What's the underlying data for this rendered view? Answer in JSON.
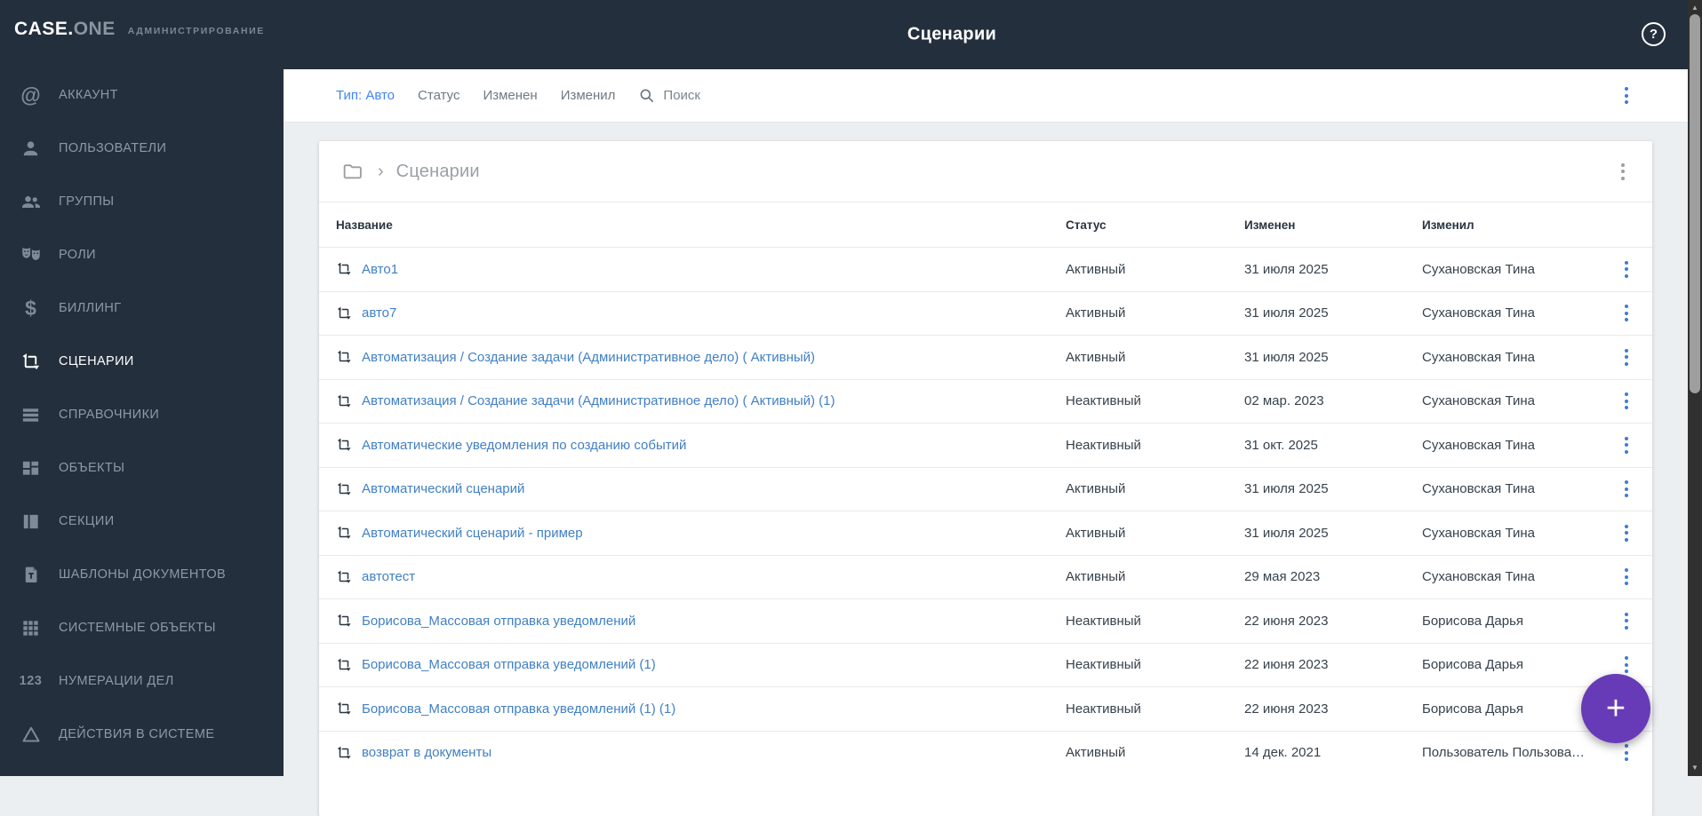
{
  "app": {
    "brand_primary": "CASE.",
    "brand_secondary": "ONE",
    "brand_sub": "АДМИНИСТРИРОВАНИЕ"
  },
  "header": {
    "title": "Сценарии"
  },
  "icons": {
    "at": "@",
    "dollar": "$",
    "numbers": "123",
    "help": "?",
    "breadcrumb_separator": "›",
    "fab_plus": "+",
    "scroll_up": "▲",
    "scroll_down": "▼"
  },
  "sidebar": {
    "items": [
      {
        "label": "АККАУНТ",
        "icon": "at-icon",
        "active": false
      },
      {
        "label": "ПОЛЬЗОВАТЕЛИ",
        "icon": "user-icon",
        "active": false
      },
      {
        "label": "ГРУППЫ",
        "icon": "users-icon",
        "active": false
      },
      {
        "label": "РОЛИ",
        "icon": "masks-icon",
        "active": false
      },
      {
        "label": "БИЛЛИНГ",
        "icon": "dollar-icon",
        "active": false
      },
      {
        "label": "СЦЕНАРИИ",
        "icon": "scenario-crop-icon",
        "active": true
      },
      {
        "label": "СПРАВОЧНИКИ",
        "icon": "list-icon",
        "active": false
      },
      {
        "label": "ОБЪЕКТЫ",
        "icon": "dashboard-icon",
        "active": false
      },
      {
        "label": "СЕКЦИИ",
        "icon": "sections-icon",
        "active": false
      },
      {
        "label": "ШАБЛОНЫ ДОКУМЕНТОВ",
        "icon": "doc-template-icon",
        "active": false
      },
      {
        "label": "СИСТЕМНЫЕ ОБЪЕКТЫ",
        "icon": "grid-icon",
        "active": false
      },
      {
        "label": "НУМЕРАЦИИ ДЕЛ",
        "icon": "numbers-icon",
        "active": false
      },
      {
        "label": "ДЕЙСТВИЯ В СИСТЕМЕ",
        "icon": "triangle-icon",
        "active": false
      }
    ]
  },
  "filters": {
    "type_label": "Тип: Авто",
    "items": [
      "Статус",
      "Изменен",
      "Изменил"
    ],
    "search_placeholder": "Поиск"
  },
  "breadcrumb": {
    "current": "Сценарии"
  },
  "table": {
    "columns": [
      "Название",
      "Статус",
      "Изменен",
      "Изменил"
    ],
    "rows": [
      {
        "name": "Авто1",
        "status": "Активный",
        "modified": "31 июля 2025",
        "modified_by": "Сухановская Тина"
      },
      {
        "name": "авто7",
        "status": "Активный",
        "modified": "31 июля 2025",
        "modified_by": "Сухановская Тина"
      },
      {
        "name": "Автоматизация / Создание задачи (Административное дело) ( Активный)",
        "status": "Активный",
        "modified": "31 июля 2025",
        "modified_by": "Сухановская Тина"
      },
      {
        "name": "Автоматизация / Создание задачи (Административное дело) ( Активный) (1)",
        "status": "Неактивный",
        "modified": "02 мар. 2023",
        "modified_by": "Сухановская Тина"
      },
      {
        "name": "Автоматические уведомления по созданию событий",
        "status": "Неактивный",
        "modified": "31 окт. 2025",
        "modified_by": "Сухановская Тина"
      },
      {
        "name": "Автоматический сценарий",
        "status": "Активный",
        "modified": "31 июля 2025",
        "modified_by": "Сухановская Тина"
      },
      {
        "name": "Автоматический сценарий - пример",
        "status": "Активный",
        "modified": "31 июля 2025",
        "modified_by": "Сухановская Тина"
      },
      {
        "name": "автотест",
        "status": "Активный",
        "modified": "29 мая 2023",
        "modified_by": "Сухановская Тина"
      },
      {
        "name": "Борисова_Массовая отправка уведомлений",
        "status": "Неактивный",
        "modified": "22 июня 2023",
        "modified_by": "Борисова Дарья"
      },
      {
        "name": "Борисова_Массовая отправка уведомлений (1)",
        "status": "Неактивный",
        "modified": "22 июня 2023",
        "modified_by": "Борисова Дарья"
      },
      {
        "name": "Борисова_Массовая отправка уведомлений (1) (1)",
        "status": "Неактивный",
        "modified": "22 июня 2023",
        "modified_by": "Борисова Дарья"
      },
      {
        "name": "возврат в документы",
        "status": "Активный",
        "modified": "14 дек. 2021",
        "modified_by": "Пользователь Пользова…"
      }
    ]
  },
  "colors": {
    "sidebar_bg": "#242f3d",
    "accent_blue": "#4285f4",
    "link_blue": "#4180c4",
    "fab_purple": "#673ab7",
    "page_bg": "#eceff1"
  }
}
